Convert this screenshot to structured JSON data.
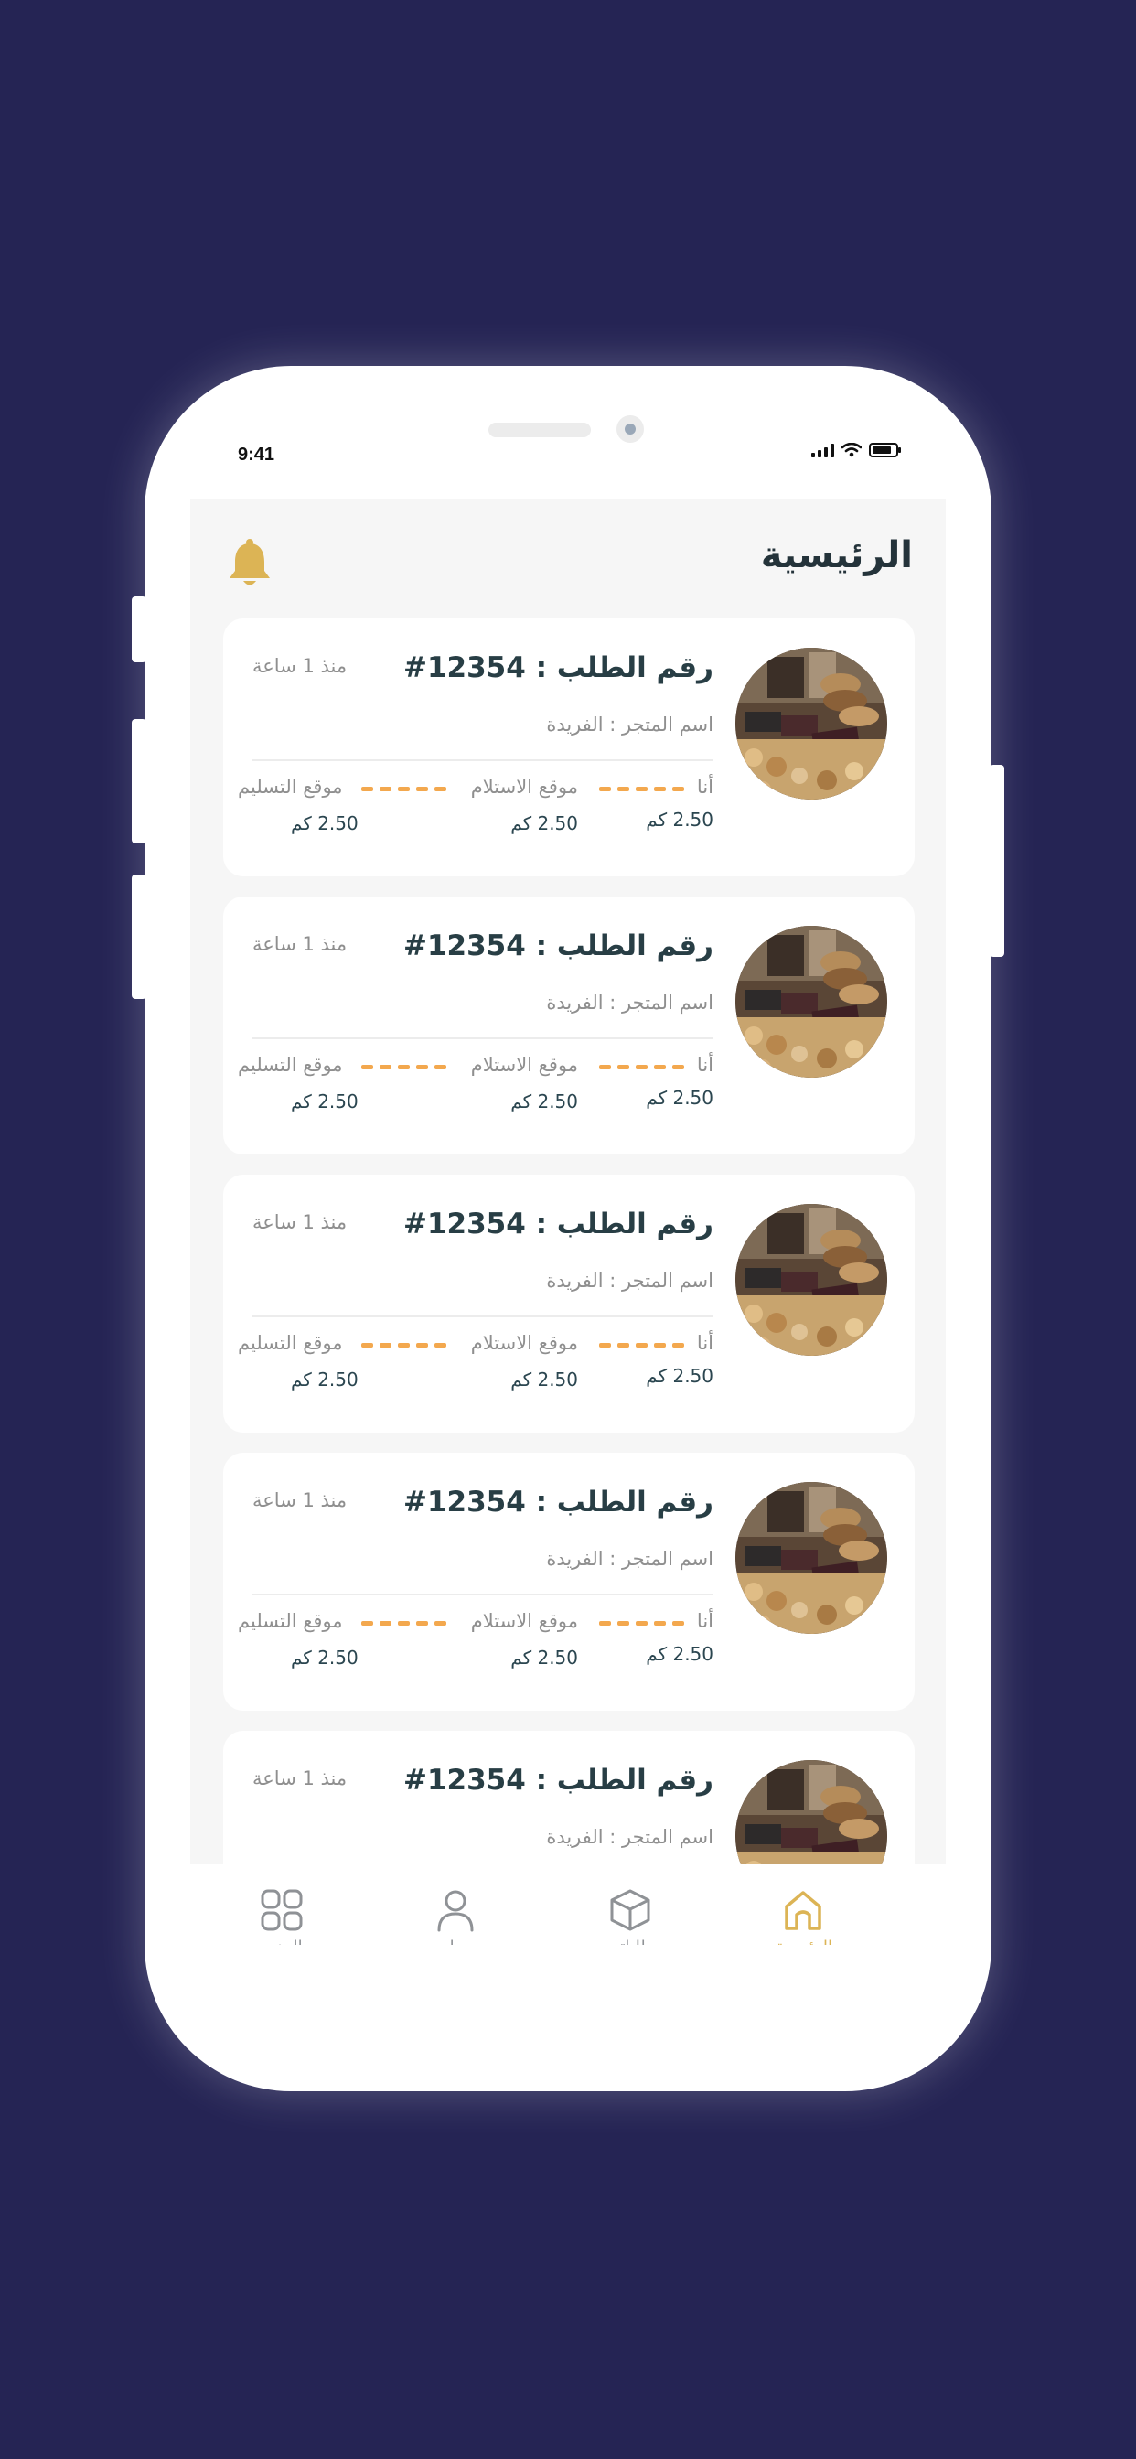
{
  "status_bar": {
    "time": "9:41"
  },
  "header": {
    "title": "الرئيسية"
  },
  "colors": {
    "accent": "#dcb455",
    "dash": "#f3a84e",
    "title_text": "#24333a",
    "background": "#252454"
  },
  "orders": [
    {
      "title": "رقم الطلب : 12354#",
      "time_ago": "منذ 1 ساعة",
      "store": "اسم المتجر : الفريدة",
      "me_label": "أنا",
      "pickup_label": "موقع الاستلام",
      "delivery_label": "موقع التسليم",
      "me_distance": "2.50 كم",
      "pickup_distance": "2.50 كم",
      "delivery_distance": "2.50 كم"
    },
    {
      "title": "رقم الطلب : 12354#",
      "time_ago": "منذ 1 ساعة",
      "store": "اسم المتجر : الفريدة",
      "me_label": "أنا",
      "pickup_label": "موقع الاستلام",
      "delivery_label": "موقع التسليم",
      "me_distance": "2.50 كم",
      "pickup_distance": "2.50 كم",
      "delivery_distance": "2.50 كم"
    },
    {
      "title": "رقم الطلب : 12354#",
      "time_ago": "منذ 1 ساعة",
      "store": "اسم المتجر : الفريدة",
      "me_label": "أنا",
      "pickup_label": "موقع الاستلام",
      "delivery_label": "موقع التسليم",
      "me_distance": "2.50 كم",
      "pickup_distance": "2.50 كم",
      "delivery_distance": "2.50 كم"
    },
    {
      "title": "رقم الطلب : 12354#",
      "time_ago": "منذ 1 ساعة",
      "store": "اسم المتجر : الفريدة",
      "me_label": "أنا",
      "pickup_label": "موقع الاستلام",
      "delivery_label": "موقع التسليم",
      "me_distance": "2.50 كم",
      "pickup_distance": "2.50 كم",
      "delivery_distance": "2.50 كم"
    },
    {
      "title": "رقم الطلب : 12354#",
      "time_ago": "منذ 1 ساعة",
      "store": "اسم المتجر : الفريدة"
    }
  ],
  "bottom_nav": [
    {
      "icon": "home-icon",
      "label": "الرئيسية",
      "active": true
    },
    {
      "icon": "box-icon",
      "label": "طلباتي",
      "active": false
    },
    {
      "icon": "user-icon",
      "label": "حسابي",
      "active": false
    },
    {
      "icon": "grid-icon",
      "label": "المزيد",
      "active": false
    }
  ]
}
